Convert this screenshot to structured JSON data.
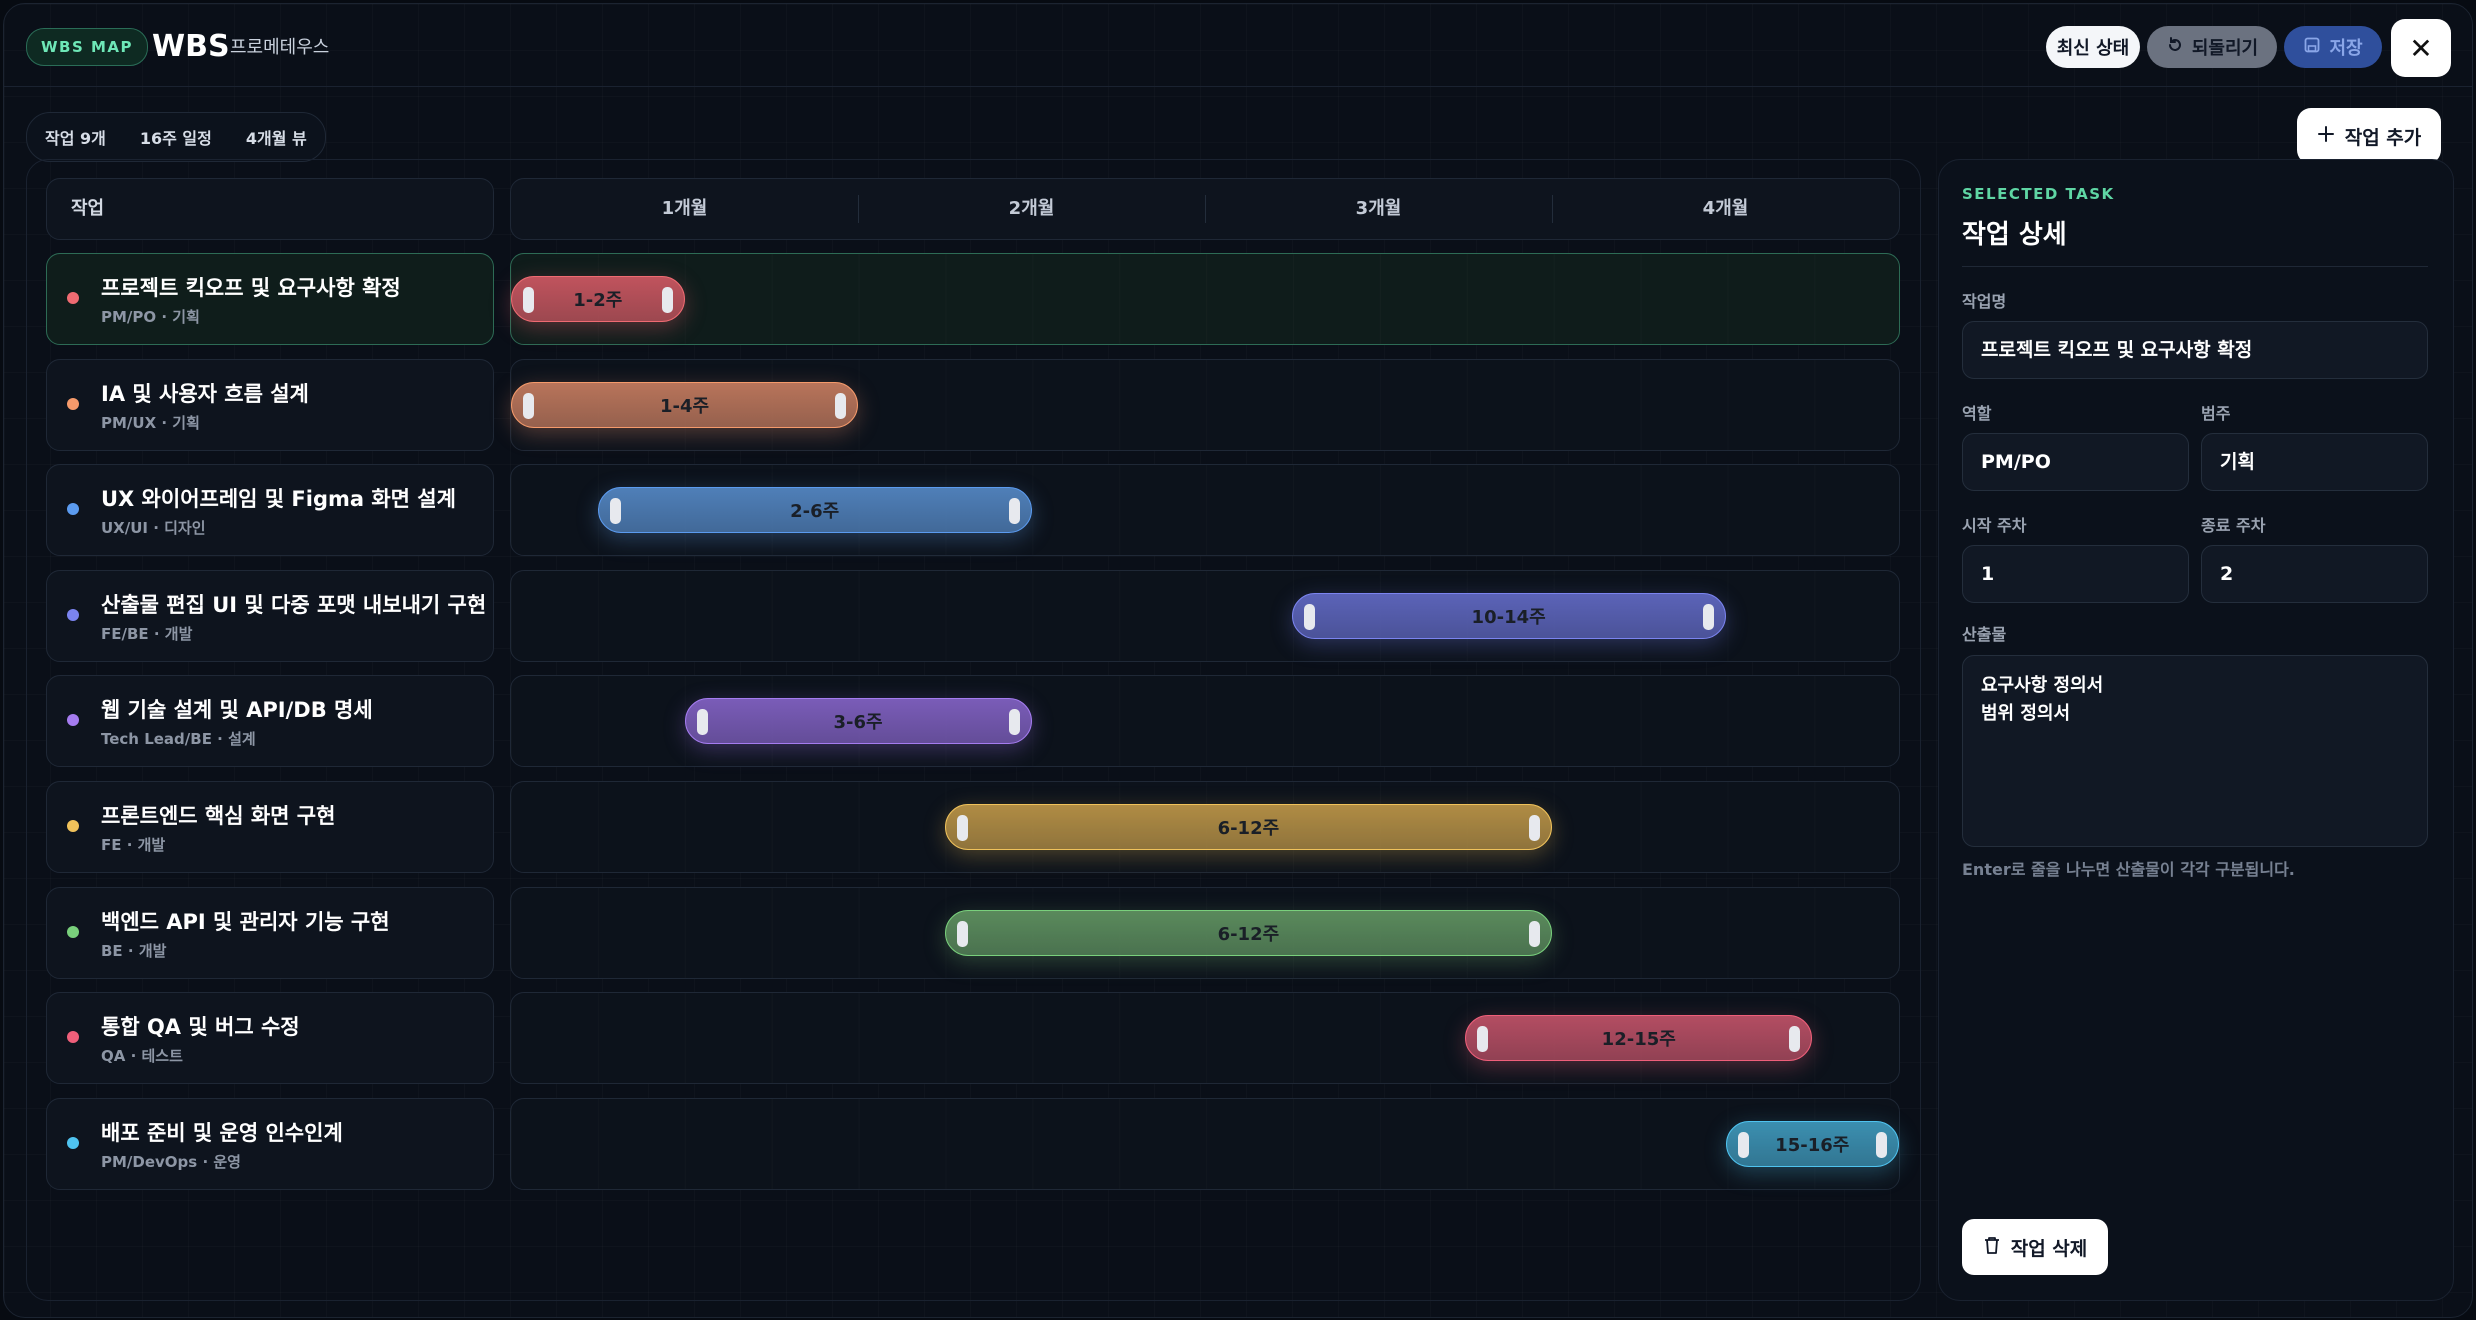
{
  "header": {
    "badge": "WBS MAP",
    "title": "WBS",
    "subtitle": "프로메테우스",
    "latest_label": "최신 상태",
    "undo_label": "되돌리기",
    "save_label": "저장",
    "close_label": "✕"
  },
  "stats": {
    "tasks": "작업 9개",
    "schedule": "16주 일정",
    "view": "4개월 뷰"
  },
  "add_task_label": "작업 추가",
  "grid": {
    "task_column_label": "작업",
    "months": [
      "1개월",
      "2개월",
      "3개월",
      "4개월"
    ],
    "total_weeks": 16
  },
  "tasks": [
    {
      "name": "프로젝트 킥오프 및 요구사항 확정",
      "meta": "PM/PO · 기획",
      "range": "1-2주",
      "start": 1,
      "end": 2,
      "color": "#c0535d",
      "dot": "#ef6b72",
      "selected": true
    },
    {
      "name": "IA 및 사용자 흐름 설계",
      "meta": "PM/UX · 기획",
      "range": "1-4주",
      "start": 1,
      "end": 4,
      "color": "#b8745a",
      "dot": "#f59a6b",
      "selected": false
    },
    {
      "name": "UX 와이어프레임 및 Figma 화면 설계",
      "meta": "UX/UI · 디자인",
      "range": "2-6주",
      "start": 2,
      "end": 6,
      "color": "#4f7fb8",
      "dot": "#5b9bf0",
      "selected": false
    },
    {
      "name": "산출물 편집 UI 및 다중 포맷 내보내기 구현",
      "meta": "FE/BE · 개발",
      "range": "10-14주",
      "start": 10,
      "end": 14,
      "color": "#5b63b8",
      "dot": "#7b84f0",
      "selected": false
    },
    {
      "name": "웹 기술 설계 및 API/DB 명세",
      "meta": "Tech Lead/BE · 설계",
      "range": "3-6주",
      "start": 3,
      "end": 6,
      "color": "#7a5cb8",
      "dot": "#a57cf0",
      "selected": false
    },
    {
      "name": "프론트엔드 핵심 화면 구현",
      "meta": "FE · 개발",
      "range": "6-12주",
      "start": 6,
      "end": 12,
      "color": "#b08c44",
      "dot": "#f0c25b",
      "selected": false
    },
    {
      "name": "백엔드 API 및 관리자 기능 구현",
      "meta": "BE · 개발",
      "range": "6-12주",
      "start": 6,
      "end": 12,
      "color": "#5a8a5c",
      "dot": "#79d07c",
      "selected": false
    },
    {
      "name": "통합 QA 및 버그 수정",
      "meta": "QA · 테스트",
      "range": "12-15주",
      "start": 12,
      "end": 15,
      "color": "#b34d62",
      "dot": "#ef5f7a",
      "selected": false
    },
    {
      "name": "배포 준비 및 운영 인수인계",
      "meta": "PM/DevOps · 운영",
      "range": "15-16주",
      "start": 15,
      "end": 16,
      "color": "#3b8fb0",
      "dot": "#4fc3f0",
      "selected": false
    }
  ],
  "detail": {
    "section_label": "SELECTED TASK",
    "title": "작업 상세",
    "name_label": "작업명",
    "name_value": "프로젝트 킥오프 및 요구사항 확정",
    "role_label": "역할",
    "role_value": "PM/PO",
    "category_label": "범주",
    "category_value": "기획",
    "start_label": "시작 주차",
    "start_value": "1",
    "end_label": "종료 주차",
    "end_value": "2",
    "deliverables_label": "산출물",
    "deliverables": [
      "요구사항 정의서",
      "범위 정의서"
    ],
    "hint": "Enter로 줄을 나누면 산출물이 각각 구분됩니다.",
    "delete_label": "작업 삭제"
  }
}
